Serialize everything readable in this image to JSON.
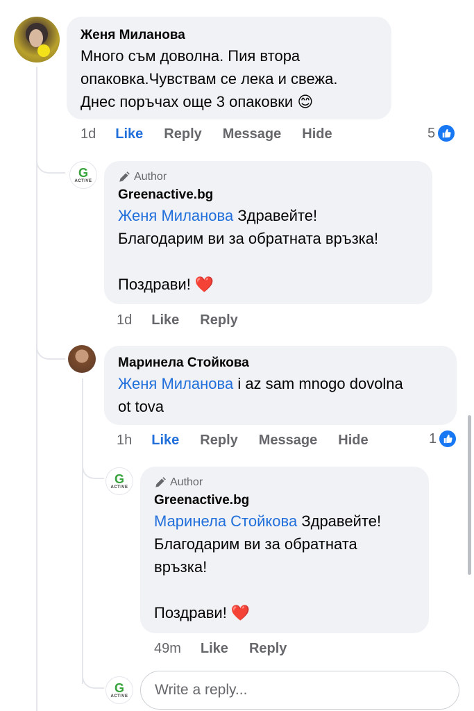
{
  "comment1": {
    "author": "Женя Миланова",
    "text": "Много съм доволна. Пия втора\nопаковка.Чувствам се лека и свежа.\nДнес поръчах още 3 опаковки 😊",
    "time": "1d",
    "like": "Like",
    "reply": "Reply",
    "message": "Message",
    "hide": "Hide",
    "reactions": "5"
  },
  "reply1": {
    "badge": "Author",
    "author": "Greenactive.bg",
    "mention": "Женя Миланова",
    "text": " Здравейте!\nБлагодарим ви за обратната връзка!\n\nПоздрави! ❤️",
    "time": "1d",
    "like": "Like",
    "reply": "Reply"
  },
  "comment2": {
    "author": "Маринела Стойкова",
    "mention": "Женя Миланова",
    "text": " i az sam mnogo dovolna\not tova",
    "time": "1h",
    "like": "Like",
    "reply": "Reply",
    "message": "Message",
    "hide": "Hide",
    "reactions": "1"
  },
  "reply2": {
    "badge": "Author",
    "author": "Greenactive.bg",
    "mention": "Маринела Стойкова",
    "text": " Здравейте!\nБлагодарим ви за обратната\nвръзка!\n\nПоздрави! ❤️",
    "time": "49m",
    "like": "Like",
    "reply": "Reply"
  },
  "reply_input": {
    "placeholder": "Write a reply..."
  },
  "brand": {
    "logo_letter": "G",
    "logo_word": "ACTIVE",
    "color": "#36a33c"
  },
  "colors": {
    "link": "#216fdb",
    "bubble": "#f0f2f5",
    "like_badge": "#1877f2"
  }
}
